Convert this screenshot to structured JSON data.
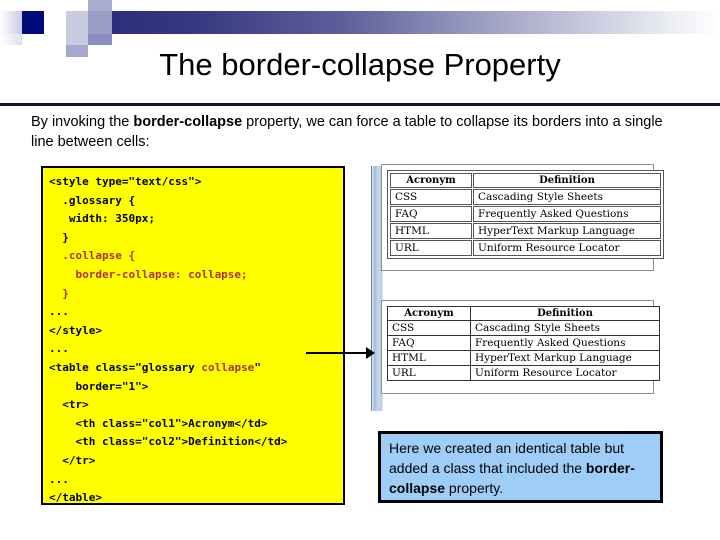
{
  "slide": {
    "title": "The border-collapse Property",
    "body_text": {
      "prefix": "By invoking the ",
      "bold": "border-collapse",
      "suffix": " property, we can force a table to collapse its borders into a single line between cells:"
    }
  },
  "code_block": {
    "lines": [
      {
        "segments": [
          {
            "text": "<style type=\"text/css\">",
            "color": "black"
          }
        ]
      },
      {
        "segments": [
          {
            "text": "  .glossary {",
            "color": "black"
          }
        ]
      },
      {
        "segments": [
          {
            "text": "   width: 350px;",
            "color": "black"
          }
        ]
      },
      {
        "segments": [
          {
            "text": "  }",
            "color": "black"
          }
        ]
      },
      {
        "segments": [
          {
            "text": "  .collapse {",
            "color": "red"
          }
        ]
      },
      {
        "segments": [
          {
            "text": "    border-collapse: collapse;",
            "color": "red"
          }
        ]
      },
      {
        "segments": [
          {
            "text": "  }",
            "color": "red"
          }
        ]
      },
      {
        "segments": [
          {
            "text": "...",
            "color": "black"
          }
        ]
      },
      {
        "segments": [
          {
            "text": "</style>",
            "color": "black"
          }
        ]
      },
      {
        "segments": [
          {
            "text": "...",
            "color": "black"
          }
        ]
      },
      {
        "segments": [
          {
            "text": "<table class=\"glossary ",
            "color": "black"
          },
          {
            "text": "collapse",
            "color": "red"
          },
          {
            "text": "\"",
            "color": "black"
          }
        ]
      },
      {
        "segments": [
          {
            "text": "    border=\"1\">",
            "color": "black"
          }
        ]
      },
      {
        "segments": [
          {
            "text": "  <tr>",
            "color": "black"
          }
        ]
      },
      {
        "segments": [
          {
            "text": "    <th class=\"col1\">Acronym</td>",
            "color": "black"
          }
        ]
      },
      {
        "segments": [
          {
            "text": "    <th class=\"col2\">Definition</td>",
            "color": "black"
          }
        ]
      },
      {
        "segments": [
          {
            "text": "  </tr>",
            "color": "black"
          }
        ]
      },
      {
        "segments": [
          {
            "text": "...",
            "color": "black"
          }
        ]
      },
      {
        "segments": [
          {
            "text": "</table>",
            "color": "black"
          }
        ]
      }
    ]
  },
  "tables": {
    "headers": [
      "Acronym",
      "Definition"
    ],
    "rows": [
      [
        "CSS",
        "Cascading Style Sheets"
      ],
      [
        "FAQ",
        "Frequently Asked Questions"
      ],
      [
        "HTML",
        "HyperText Markup Language"
      ],
      [
        "URL",
        "Uniform Resource Locator"
      ]
    ]
  },
  "caption": {
    "line1": "Here we created an identical table",
    "line2": "but added a class that included the",
    "bold": "border-collapse",
    "tail": " property."
  },
  "colors": {
    "code_background": "#ffff00",
    "code_highlight": "#b03030",
    "caption_background": "#9ecef8",
    "header_band": "#2c2f7b",
    "rule": "#111133"
  }
}
